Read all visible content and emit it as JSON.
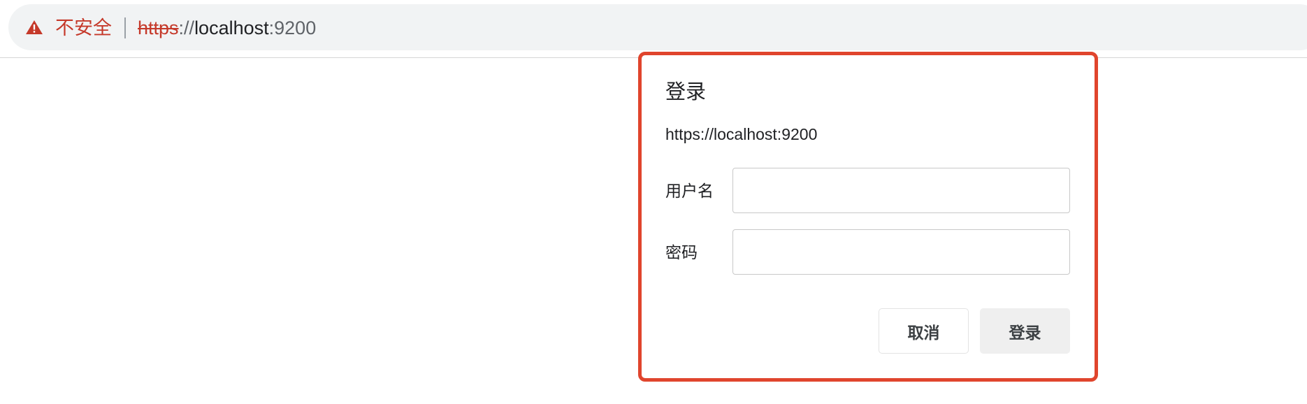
{
  "address_bar": {
    "security_label": "不安全",
    "url": {
      "scheme": "https",
      "separator": "://",
      "host": "localhost",
      "port": ":9200"
    },
    "warning_icon": "warning-triangle-icon",
    "security_color": "#c5392a"
  },
  "dialog": {
    "title": "登录",
    "origin": "https://localhost:9200",
    "username_label": "用户名",
    "username_value": "",
    "password_label": "密码",
    "password_value": "",
    "cancel_label": "取消",
    "submit_label": "登录",
    "highlight_color": "#e0452d"
  }
}
